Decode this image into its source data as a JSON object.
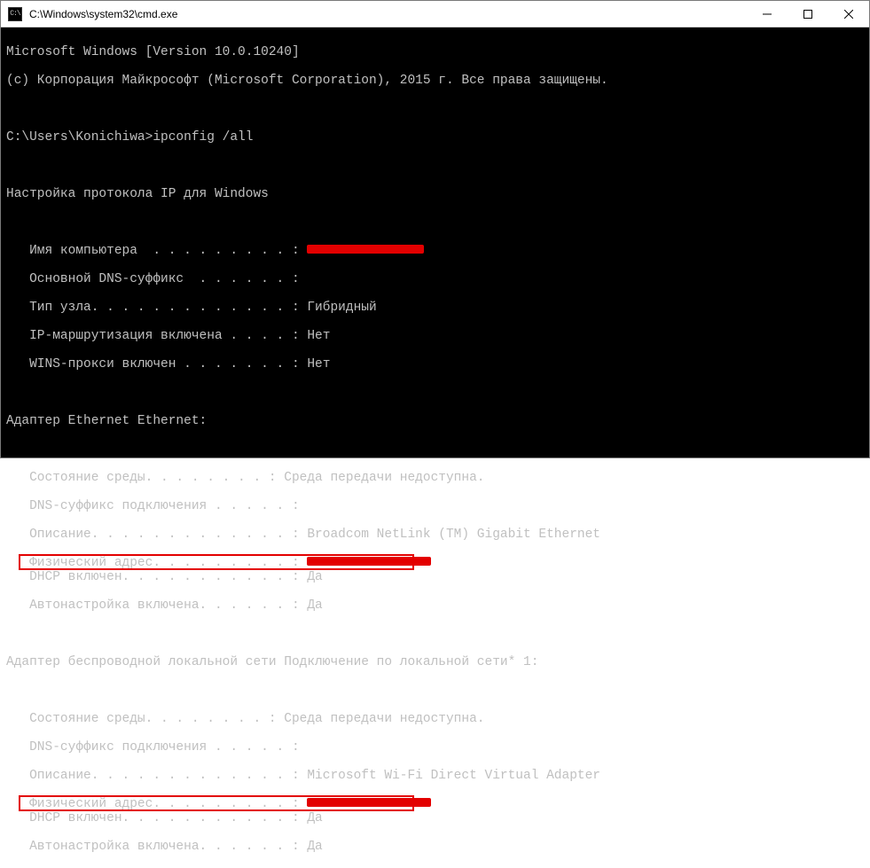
{
  "titlebar": {
    "path": "C:\\Windows\\system32\\cmd.exe",
    "icon_label": "C:\\",
    "minimize": "—",
    "maximize": "☐",
    "close": "✕"
  },
  "terminal": {
    "header1": "Microsoft Windows [Version 10.0.10240]",
    "header2": "(c) Корпорация Майкрософт (Microsoft Corporation), 2015 г. Все права защищены.",
    "prompt": "C:\\Users\\Konichiwa>ipconfig /all",
    "section_title": "Настройка протокола IP для Windows",
    "host": {
      "name_label": "   Имя компьютера  . . . . . . . . . : ",
      "name_redacted": true,
      "dns_suffix": "   Основной DNS-суффикс  . . . . . . :",
      "node_type": "   Тип узла. . . . . . . . . . . . . : Гибридный",
      "ip_routing": "   IP-маршрутизация включена . . . . : Нет",
      "wins_proxy": "   WINS-прокси включен . . . . . . . : Нет"
    },
    "adapter1": {
      "title": "Адаптер Ethernet Ethernet:",
      "media_state": "   Состояние среды. . . . . . . . : Среда передачи недоступна.",
      "dns_suffix": "   DNS-суффикс подключения . . . . . :",
      "description": "   Описание. . . . . . . . . . . . . : Broadcom NetLink (TM) Gigabit Ethernet",
      "mac_label": "   Физический адрес. . . . . . . . . : ",
      "mac_redacted": true,
      "dhcp": "   DHCP включен. . . . . . . . . . . : Да",
      "autoconf": "   Автонастройка включена. . . . . . : Да"
    },
    "adapter2": {
      "title": "Адаптер беспроводной локальной сети Подключение по локальной сети* 1:",
      "media_state": "   Состояние среды. . . . . . . . : Среда передачи недоступна.",
      "dns_suffix": "   DNS-суффикс подключения . . . . . :",
      "description": "   Описание. . . . . . . . . . . . . : Microsoft Wi-Fi Direct Virtual Adapter",
      "mac_label": "   Физический адрес. . . . . . . . . : ",
      "mac_redacted": true,
      "dhcp": "   DHCP включен. . . . . . . . . . . : Да",
      "autoconf": "   Автонастройка включена. . . . . . : Да"
    }
  }
}
